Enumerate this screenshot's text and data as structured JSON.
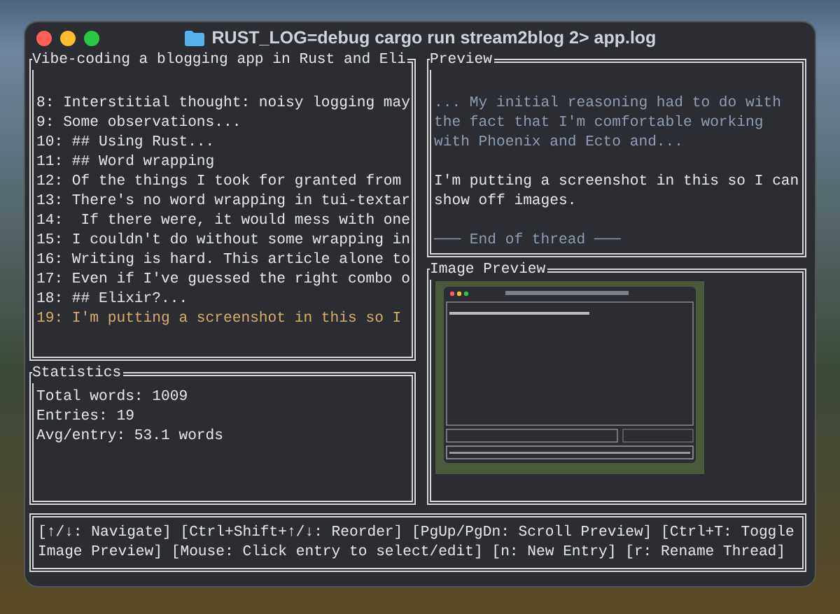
{
  "window": {
    "title": "RUST_LOG=debug cargo run stream2blog 2> app.log"
  },
  "entries_panel": {
    "title": "Vibe-coding a blogging app in Rust and Eli",
    "entries": [
      {
        "text": "8: Interstitial thought: noisy logging may",
        "selected": false
      },
      {
        "text": "9: Some observations...",
        "selected": false
      },
      {
        "text": "10: ## Using Rust...",
        "selected": false
      },
      {
        "text": "11: ## Word wrapping",
        "selected": false
      },
      {
        "text": "12: Of the things I took for granted from",
        "selected": false
      },
      {
        "text": "13: There's no word wrapping in tui-textar",
        "selected": false
      },
      {
        "text": "14:  If there were, it would mess with one",
        "selected": false
      },
      {
        "text": "15: I couldn't do without some wrapping in",
        "selected": false
      },
      {
        "text": "16: Writing is hard. This article alone to",
        "selected": false
      },
      {
        "text": "17: Even if I've guessed the right combo o",
        "selected": false
      },
      {
        "text": "18: ## Elixir?...",
        "selected": false
      },
      {
        "text": "19: I'm putting a screenshot in this so I",
        "selected": true
      }
    ]
  },
  "statistics": {
    "title": "Statistics",
    "lines": [
      "Total words: 1009",
      "Entries: 19",
      "Avg/entry: 53.1 words"
    ]
  },
  "preview": {
    "title": "Preview",
    "paragraphs": [
      {
        "kind": "previous",
        "text": "... My initial reasoning had to do with the fact that I'm comfortable working with Phoenix and Ecto and..."
      },
      {
        "kind": "current",
        "text": "I'm putting a screenshot in this so I can show off images."
      },
      {
        "kind": "divider",
        "text": "─── End of thread ───"
      }
    ]
  },
  "image_preview": {
    "title": "Image Preview"
  },
  "help_bar": {
    "text": "[↑/↓: Navigate] [Ctrl+Shift+↑/↓: Reorder] [PgUp/PgDn: Scroll Preview] [Ctrl+T: Toggle Image Preview] [Mouse: Click entry to select/edit] [n: New Entry] [r: Rename Thread]"
  }
}
